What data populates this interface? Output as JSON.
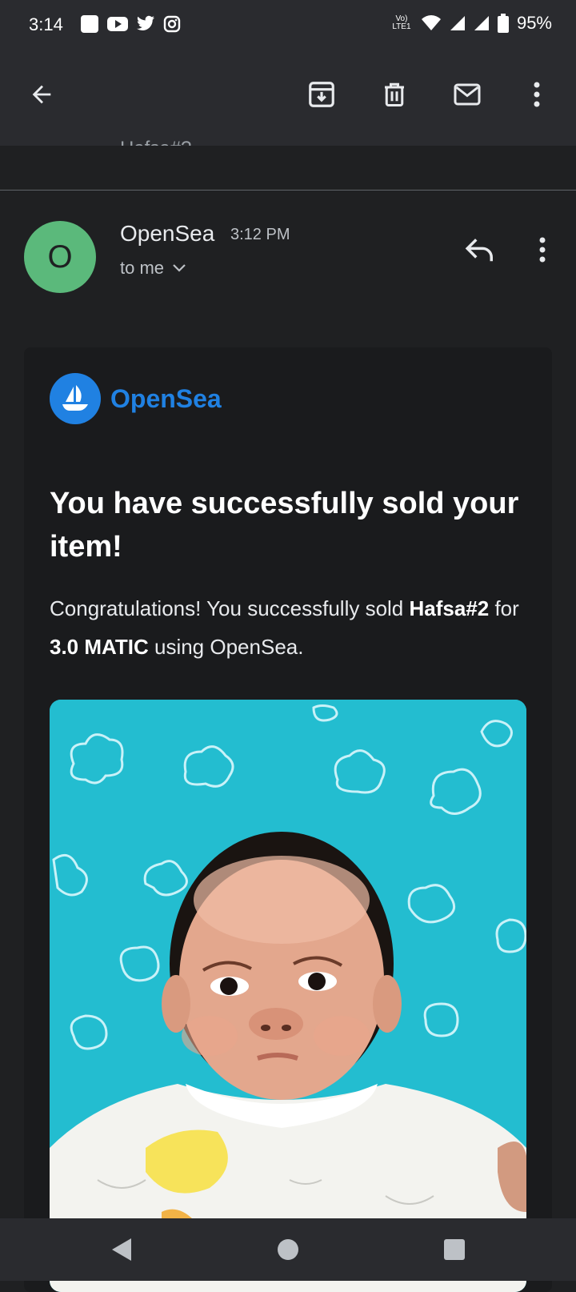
{
  "status_bar": {
    "time": "3:14",
    "battery_percent": "95%",
    "network_label_top": "Vo)",
    "network_label_bottom": "LTE1",
    "notification_icons": [
      "square-icon",
      "youtube-icon",
      "twitter-icon",
      "instagram-icon"
    ]
  },
  "toolbar": {
    "back_icon": "arrow-back-icon",
    "archive_icon": "archive-icon",
    "delete_icon": "trash-icon",
    "mark_unread_icon": "mail-icon",
    "more_icon": "more-vert-icon"
  },
  "previous_message_peek": "Hafsa#?",
  "message": {
    "avatar_letter": "O",
    "sender": "OpenSea",
    "time": "3:12 PM",
    "recipient": "to me",
    "reply_icon": "reply-icon",
    "more_icon": "more-vert-icon"
  },
  "email_body": {
    "brand_name": "OpenSea",
    "headline": "You have successfully sold your item!",
    "text_intro": "Congratulations! You successfully sold ",
    "item_name": "Hafsa#2",
    "text_for": " for ",
    "price": "3.0 MATIC",
    "text_end": " using OpenSea."
  },
  "colors": {
    "brand": "#2081e2",
    "avatar": "#5bb97b",
    "background": "#1f2022",
    "image_background": "#23bdd0"
  },
  "nav_bar": {
    "back_icon": "nav-back-icon",
    "home_icon": "nav-home-icon",
    "recents_icon": "nav-recents-icon"
  }
}
